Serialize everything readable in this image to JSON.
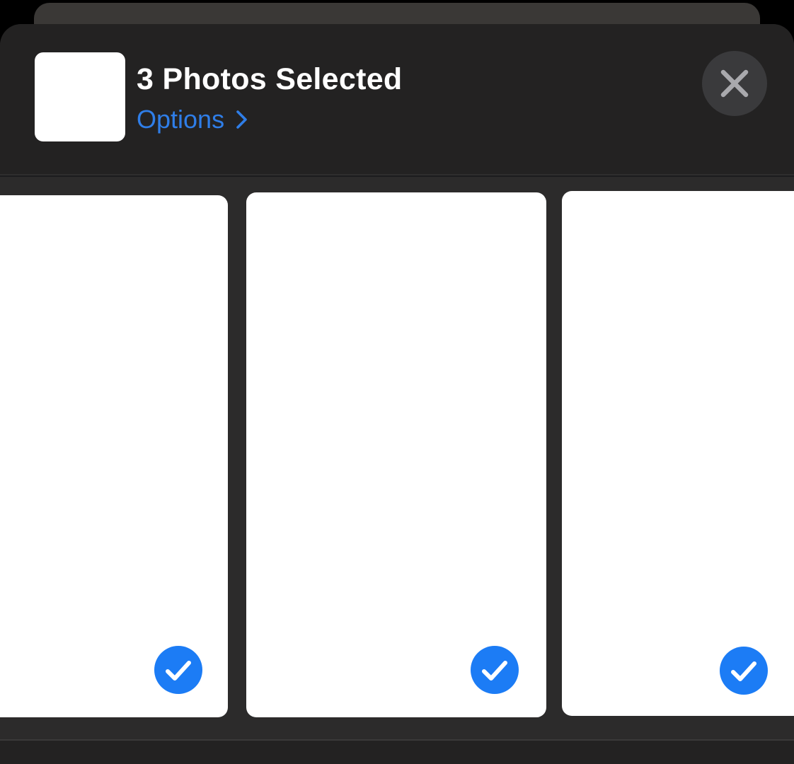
{
  "header": {
    "title": "3 Photos Selected",
    "options_label": "Options",
    "options_icon": "chevron-right-icon",
    "close_icon": "close-icon",
    "thumbnail": "photo-stack-thumbnail"
  },
  "photos": [
    {
      "selected": true,
      "badge_icon": "checkmark-circle-icon"
    },
    {
      "selected": true,
      "badge_icon": "checkmark-circle-icon"
    },
    {
      "selected": true,
      "badge_icon": "checkmark-circle-icon"
    }
  ],
  "colors": {
    "accent": "#2f7ee8",
    "check_badge": "#1c7cf5",
    "sheet_background": "#232222",
    "strip_background": "#2c2b2b"
  }
}
